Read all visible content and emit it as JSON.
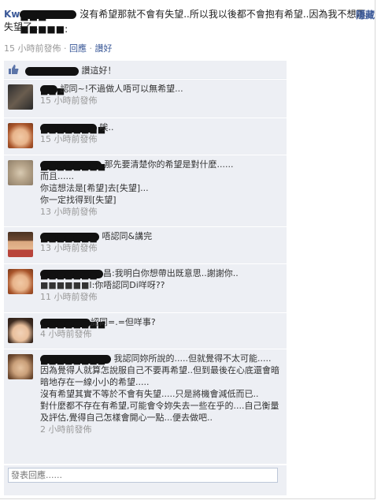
{
  "status": {
    "author_prefix": "Kw",
    "author_hidden": "■■■ ■■■■■:",
    "body": "沒有希望那就不會有失望..所以我以後都不會抱有希望..因為我不想再失望了..",
    "hide_label": "隱藏",
    "time": "15 小時前發佈",
    "comment_link": "回應",
    "like_link": "讚好"
  },
  "likes": {
    "text": "讚這好！"
  },
  "comments": [
    {
      "name_hidden": "■■■",
      "text": "認同~!不過做人唔可以無希望...",
      "time": "15 小時前發佈"
    },
    {
      "name_hidden": "■■■■■■■■",
      "text": "唉..",
      "time": "15 小時前發佈"
    },
    {
      "name_hidden": "■■■■■■■■",
      "text": "那先要清楚你的希望是對什麼......\n而且......\n你這想法是[希望]去[失望]...\n你一定找得到[失望]",
      "time": "13 小時前發佈"
    },
    {
      "name_hidden": "■■■■■■■",
      "text": "唔認同&講完",
      "time": "13 小時前發佈"
    },
    {
      "name_hidden": "■■■■■■■",
      "text": "昌:我明白你想帶出既意思..謝謝你..\n■■■■■■I:你唔認同Di咩呀??",
      "time": "11 小時前發佈"
    },
    {
      "name_hidden": "■■■■■■■■",
      "text": "認同=.=但咩事?",
      "time": "4 小時前發佈"
    },
    {
      "name_hidden": "■■■■■■■■",
      "text": "我認同妳所說的.....但就覺得不太可能.....\n因為覺得人就算怎說服自己不要再希望..但到最後在心底還會暗暗地存在一線小小的希望.....\n沒有希望其實不等於不會有失望.....只是將機會減低而已..\n對什麼都不存在有希望,可能會令妳失去一些在乎的....自己衡量及評估,覺得自己怎樣會開心一點...便去做吧..",
      "time": "2 小時前發佈"
    }
  ],
  "reply": {
    "placeholder": "發表回應......"
  },
  "colors": {
    "link": "#3b5998",
    "panel": "#edeff4",
    "meta": "#999999"
  }
}
